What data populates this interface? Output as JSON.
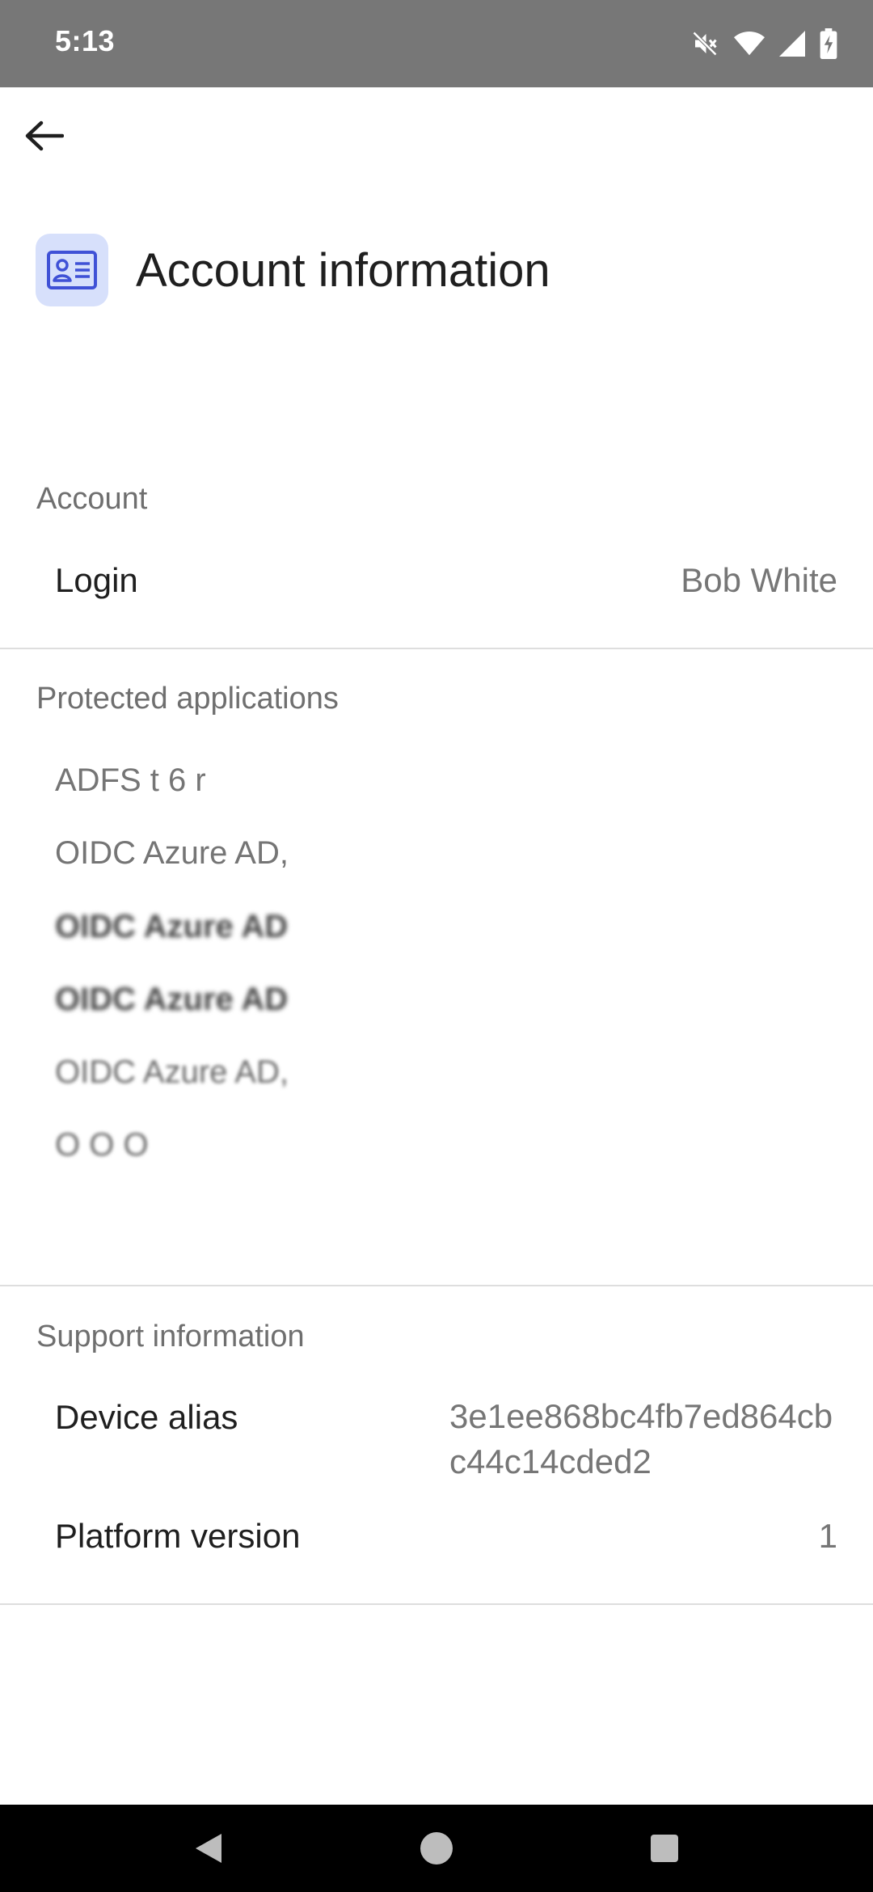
{
  "status_bar": {
    "time": "5:13",
    "icons": [
      "mute-icon",
      "wifi-icon",
      "signal-icon",
      "battery-charging-icon"
    ]
  },
  "app_bar": {
    "back_icon": "arrow-back-icon"
  },
  "header": {
    "title": "Account information",
    "icon": "id-card-icon",
    "icon_bg": "#d7e0fb",
    "icon_color": "#3f51d6"
  },
  "account": {
    "section_title": "Account",
    "login_label": "Login",
    "login_value": "Bob White"
  },
  "protected": {
    "section_title": "Protected applications",
    "apps": [
      "ADFS t 6 r",
      "OIDC Azure AD,",
      "OIDC Azure AD",
      "OIDC Azure AD",
      "OIDC Azure AD,",
      "O  O  O"
    ]
  },
  "support": {
    "section_title": "Support information",
    "device_alias_label": "Device alias",
    "device_alias_value": "3e1ee868bc4fb7ed864cbc44c14cded2",
    "platform_version_label": "Platform version",
    "platform_version_value": "1"
  },
  "nav_bar": {
    "buttons": [
      "nav-back-icon",
      "nav-home-icon",
      "nav-recents-icon"
    ]
  }
}
